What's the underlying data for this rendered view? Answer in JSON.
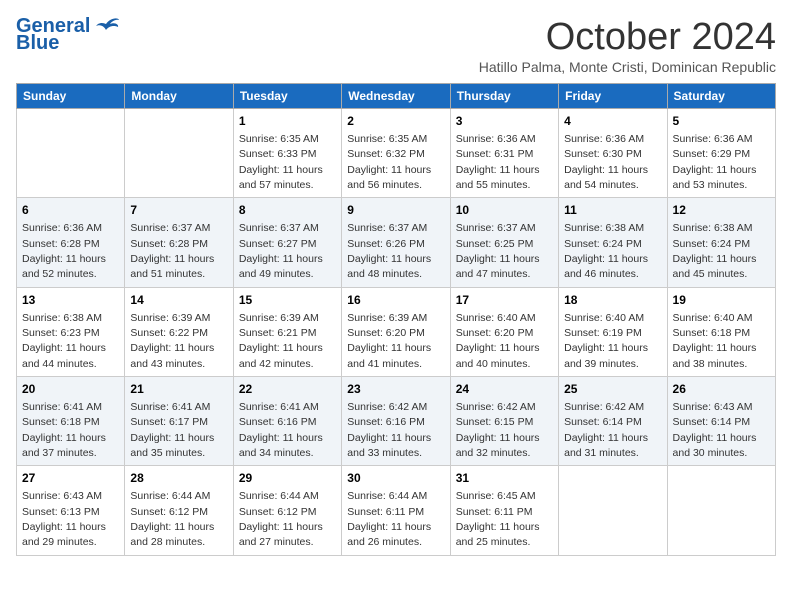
{
  "header": {
    "logo_line1": "General",
    "logo_line2": "Blue",
    "month_title": "October 2024",
    "subtitle": "Hatillo Palma, Monte Cristi, Dominican Republic"
  },
  "weekdays": [
    "Sunday",
    "Monday",
    "Tuesday",
    "Wednesday",
    "Thursday",
    "Friday",
    "Saturday"
  ],
  "weeks": [
    [
      {
        "day": "",
        "info": ""
      },
      {
        "day": "",
        "info": ""
      },
      {
        "day": "1",
        "info": "Sunrise: 6:35 AM\nSunset: 6:33 PM\nDaylight: 11 hours and 57 minutes."
      },
      {
        "day": "2",
        "info": "Sunrise: 6:35 AM\nSunset: 6:32 PM\nDaylight: 11 hours and 56 minutes."
      },
      {
        "day": "3",
        "info": "Sunrise: 6:36 AM\nSunset: 6:31 PM\nDaylight: 11 hours and 55 minutes."
      },
      {
        "day": "4",
        "info": "Sunrise: 6:36 AM\nSunset: 6:30 PM\nDaylight: 11 hours and 54 minutes."
      },
      {
        "day": "5",
        "info": "Sunrise: 6:36 AM\nSunset: 6:29 PM\nDaylight: 11 hours and 53 minutes."
      }
    ],
    [
      {
        "day": "6",
        "info": "Sunrise: 6:36 AM\nSunset: 6:28 PM\nDaylight: 11 hours and 52 minutes."
      },
      {
        "day": "7",
        "info": "Sunrise: 6:37 AM\nSunset: 6:28 PM\nDaylight: 11 hours and 51 minutes."
      },
      {
        "day": "8",
        "info": "Sunrise: 6:37 AM\nSunset: 6:27 PM\nDaylight: 11 hours and 49 minutes."
      },
      {
        "day": "9",
        "info": "Sunrise: 6:37 AM\nSunset: 6:26 PM\nDaylight: 11 hours and 48 minutes."
      },
      {
        "day": "10",
        "info": "Sunrise: 6:37 AM\nSunset: 6:25 PM\nDaylight: 11 hours and 47 minutes."
      },
      {
        "day": "11",
        "info": "Sunrise: 6:38 AM\nSunset: 6:24 PM\nDaylight: 11 hours and 46 minutes."
      },
      {
        "day": "12",
        "info": "Sunrise: 6:38 AM\nSunset: 6:24 PM\nDaylight: 11 hours and 45 minutes."
      }
    ],
    [
      {
        "day": "13",
        "info": "Sunrise: 6:38 AM\nSunset: 6:23 PM\nDaylight: 11 hours and 44 minutes."
      },
      {
        "day": "14",
        "info": "Sunrise: 6:39 AM\nSunset: 6:22 PM\nDaylight: 11 hours and 43 minutes."
      },
      {
        "day": "15",
        "info": "Sunrise: 6:39 AM\nSunset: 6:21 PM\nDaylight: 11 hours and 42 minutes."
      },
      {
        "day": "16",
        "info": "Sunrise: 6:39 AM\nSunset: 6:20 PM\nDaylight: 11 hours and 41 minutes."
      },
      {
        "day": "17",
        "info": "Sunrise: 6:40 AM\nSunset: 6:20 PM\nDaylight: 11 hours and 40 minutes."
      },
      {
        "day": "18",
        "info": "Sunrise: 6:40 AM\nSunset: 6:19 PM\nDaylight: 11 hours and 39 minutes."
      },
      {
        "day": "19",
        "info": "Sunrise: 6:40 AM\nSunset: 6:18 PM\nDaylight: 11 hours and 38 minutes."
      }
    ],
    [
      {
        "day": "20",
        "info": "Sunrise: 6:41 AM\nSunset: 6:18 PM\nDaylight: 11 hours and 37 minutes."
      },
      {
        "day": "21",
        "info": "Sunrise: 6:41 AM\nSunset: 6:17 PM\nDaylight: 11 hours and 35 minutes."
      },
      {
        "day": "22",
        "info": "Sunrise: 6:41 AM\nSunset: 6:16 PM\nDaylight: 11 hours and 34 minutes."
      },
      {
        "day": "23",
        "info": "Sunrise: 6:42 AM\nSunset: 6:16 PM\nDaylight: 11 hours and 33 minutes."
      },
      {
        "day": "24",
        "info": "Sunrise: 6:42 AM\nSunset: 6:15 PM\nDaylight: 11 hours and 32 minutes."
      },
      {
        "day": "25",
        "info": "Sunrise: 6:42 AM\nSunset: 6:14 PM\nDaylight: 11 hours and 31 minutes."
      },
      {
        "day": "26",
        "info": "Sunrise: 6:43 AM\nSunset: 6:14 PM\nDaylight: 11 hours and 30 minutes."
      }
    ],
    [
      {
        "day": "27",
        "info": "Sunrise: 6:43 AM\nSunset: 6:13 PM\nDaylight: 11 hours and 29 minutes."
      },
      {
        "day": "28",
        "info": "Sunrise: 6:44 AM\nSunset: 6:12 PM\nDaylight: 11 hours and 28 minutes."
      },
      {
        "day": "29",
        "info": "Sunrise: 6:44 AM\nSunset: 6:12 PM\nDaylight: 11 hours and 27 minutes."
      },
      {
        "day": "30",
        "info": "Sunrise: 6:44 AM\nSunset: 6:11 PM\nDaylight: 11 hours and 26 minutes."
      },
      {
        "day": "31",
        "info": "Sunrise: 6:45 AM\nSunset: 6:11 PM\nDaylight: 11 hours and 25 minutes."
      },
      {
        "day": "",
        "info": ""
      },
      {
        "day": "",
        "info": ""
      }
    ]
  ]
}
